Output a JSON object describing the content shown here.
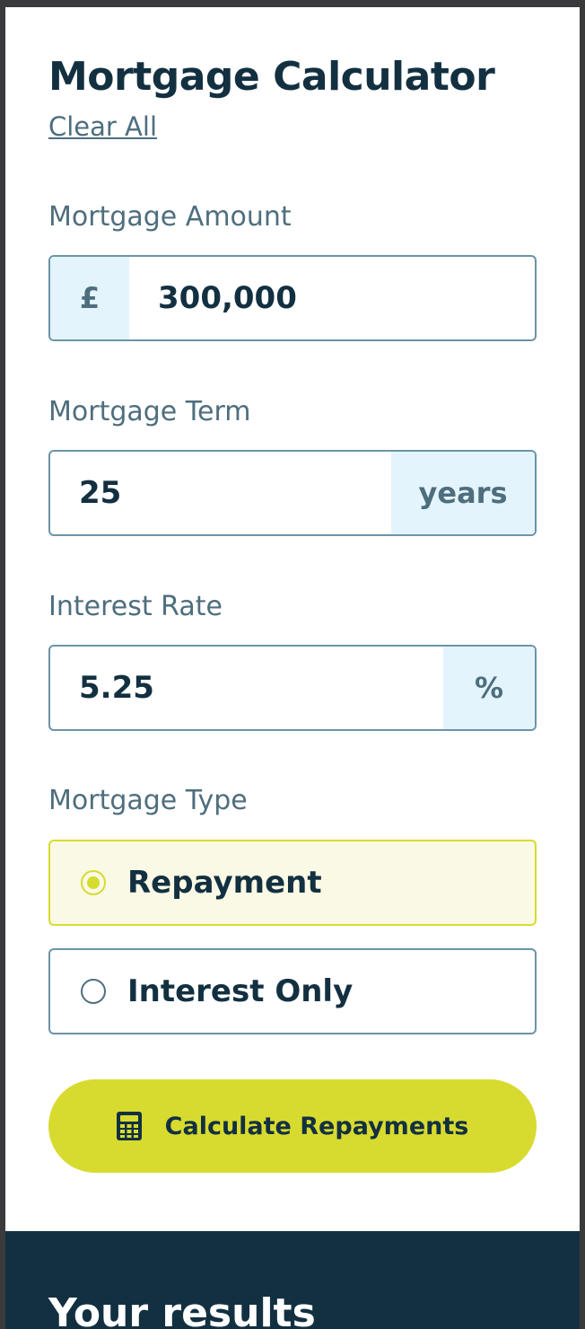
{
  "title": "Mortgage Calculator",
  "clear_all": "Clear All",
  "amount": {
    "label": "Mortgage Amount",
    "prefix": "£",
    "value": "300,000"
  },
  "term": {
    "label": "Mortgage Term",
    "value": "25",
    "suffix": "years"
  },
  "rate": {
    "label": "Interest Rate",
    "value": "5.25",
    "suffix": "%"
  },
  "type": {
    "label": "Mortgage Type",
    "options": [
      {
        "label": "Repayment",
        "selected": true
      },
      {
        "label": "Interest Only",
        "selected": false
      }
    ]
  },
  "calculate": {
    "label": "Calculate Repayments",
    "icon": "calculator-icon"
  },
  "results": {
    "title": "Your results"
  },
  "colors": {
    "primary_dark": "#133041",
    "accent_lime": "#d8db2f",
    "addon_bg": "#e3f4fc",
    "muted_text": "#4e6e7e",
    "border": "#6b94a8"
  }
}
